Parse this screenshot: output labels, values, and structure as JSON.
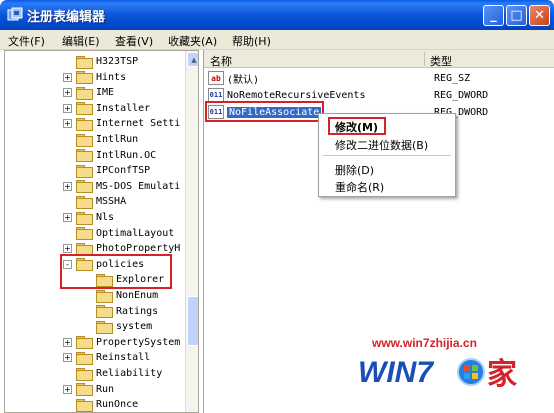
{
  "window": {
    "title": "注册表编辑器"
  },
  "menu": [
    "文件(F)",
    "编辑(E)",
    "查看(V)",
    "收藏夹(A)",
    "帮助(H)"
  ],
  "tree": [
    {
      "label": "H323TSP",
      "expander": "",
      "indent": 0
    },
    {
      "label": "Hints",
      "expander": "+",
      "indent": 0
    },
    {
      "label": "IME",
      "expander": "+",
      "indent": 0
    },
    {
      "label": "Installer",
      "expander": "+",
      "indent": 0
    },
    {
      "label": "Internet Setti",
      "expander": "+",
      "indent": 0
    },
    {
      "label": "IntlRun",
      "expander": "",
      "indent": 0
    },
    {
      "label": "IntlRun.OC",
      "expander": "",
      "indent": 0
    },
    {
      "label": "IPConfTSP",
      "expander": "",
      "indent": 0
    },
    {
      "label": "MS-DOS Emulati",
      "expander": "+",
      "indent": 0
    },
    {
      "label": "MSSHA",
      "expander": "",
      "indent": 0
    },
    {
      "label": "Nls",
      "expander": "+",
      "indent": 0
    },
    {
      "label": "OptimalLayout",
      "expander": "",
      "indent": 0
    },
    {
      "label": "PhotoPropertyH",
      "expander": "+",
      "indent": 0
    },
    {
      "label": "policies",
      "expander": "-",
      "indent": 0
    },
    {
      "label": "Explorer",
      "expander": "",
      "indent": 1
    },
    {
      "label": "NonEnum",
      "expander": "",
      "indent": 1
    },
    {
      "label": "Ratings",
      "expander": "",
      "indent": 1
    },
    {
      "label": "system",
      "expander": "",
      "indent": 1
    },
    {
      "label": "PropertySystem",
      "expander": "+",
      "indent": 0
    },
    {
      "label": "Reinstall",
      "expander": "+",
      "indent": 0
    },
    {
      "label": "Reliability",
      "expander": "",
      "indent": 0
    },
    {
      "label": "Run",
      "expander": "+",
      "indent": 0
    },
    {
      "label": "RunOnce",
      "expander": "",
      "indent": 0
    }
  ],
  "columns": {
    "name": "名称",
    "type": "类型"
  },
  "values": [
    {
      "icon": "ab",
      "name": "(默认)",
      "type": "REG_SZ"
    },
    {
      "icon": "011",
      "name": "NoRemoteRecursiveEvents",
      "type": "REG_DWORD"
    },
    {
      "icon": "011",
      "name": "NoFileAssociate",
      "type": "REG_DWORD"
    }
  ],
  "context_menu": [
    "修改(M)",
    "修改二进位数据(B)",
    "删除(D)",
    "重命名(R)"
  ],
  "watermark": {
    "url": "www.win7zhijia.cn",
    "logo_text": "WIN7",
    "logo_suffix": "家"
  },
  "colors": {
    "titlebar": "#0a55d8",
    "highlight": "#d2232a",
    "selection": "#316ac5"
  }
}
